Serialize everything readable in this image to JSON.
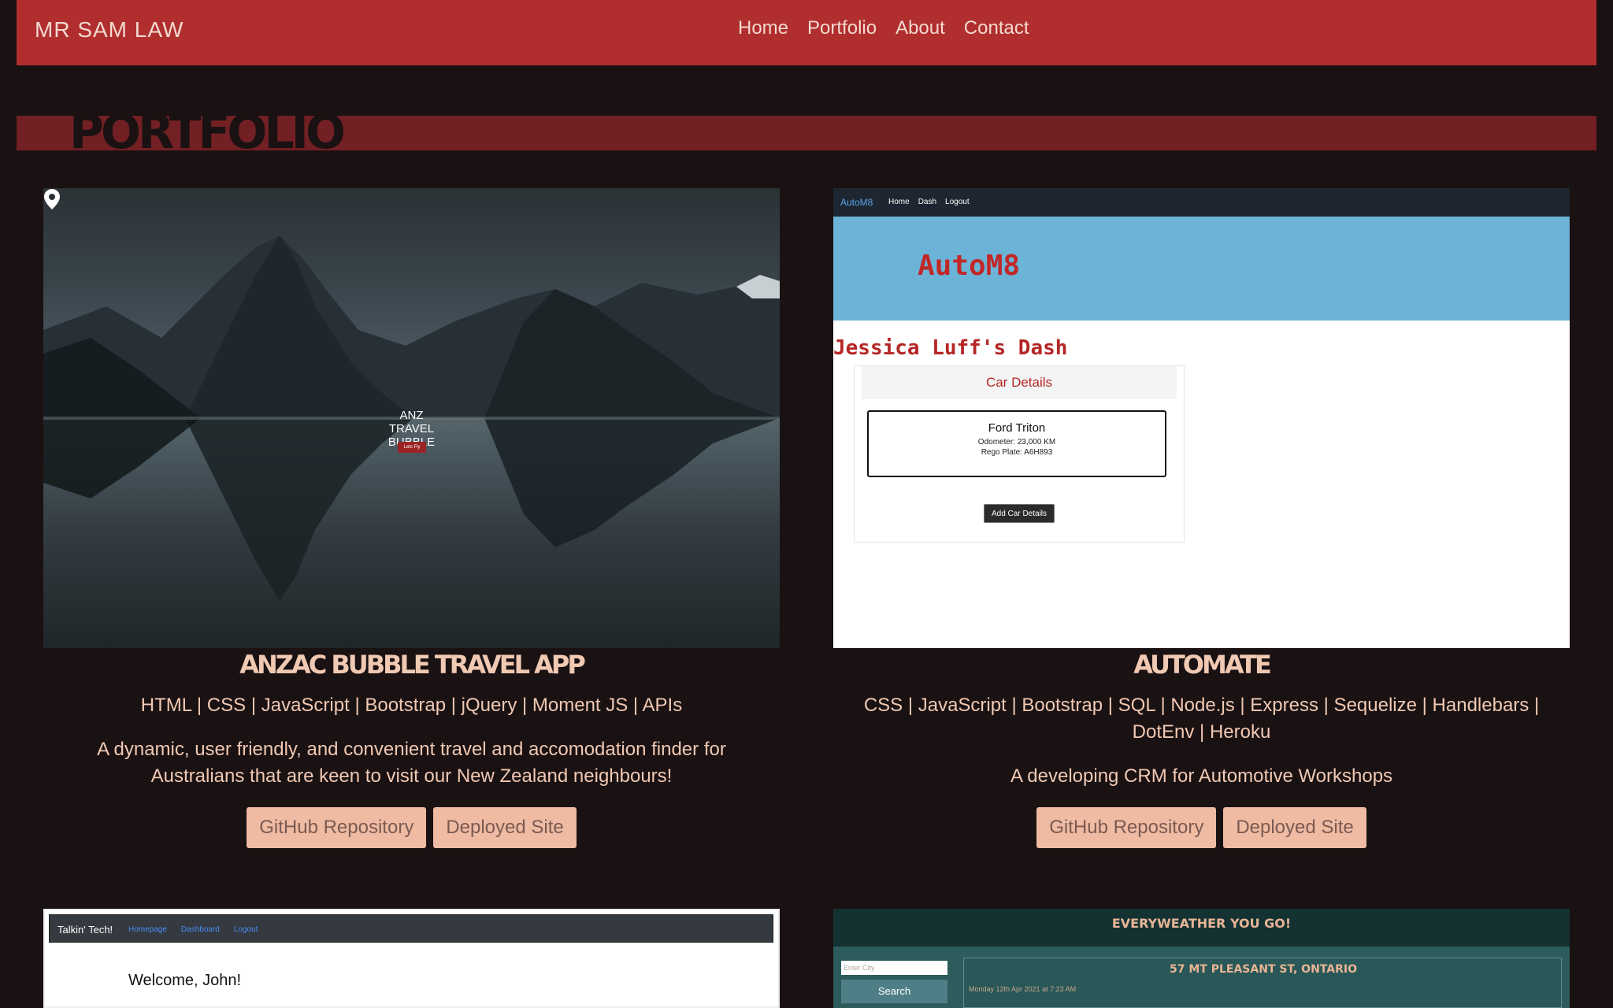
{
  "nav": {
    "brand": "MR SAM LAW",
    "links": [
      "Home",
      "Portfolio",
      "About",
      "Contact"
    ]
  },
  "section": {
    "title": "PORTFOLIO"
  },
  "projects": [
    {
      "title": "ANZAC BUBBLE TRAVEL APP",
      "tech": "HTML | CSS | JavaScript | Bootstrap | jQuery | Moment JS | APIs",
      "description": "A dynamic, user friendly, and convenient travel and accomodation finder for Australians that are keen to visit our New Zealand neighbours!",
      "github_label": "GitHub Repository",
      "deployed_label": "Deployed Site",
      "shot": {
        "title": "ANZ TRAVEL BUBBLE",
        "button": "Lets Fly"
      }
    },
    {
      "title": "AUTOMATE",
      "tech": "CSS | JavaScript | Bootstrap | SQL | Node.js | Express | Sequelize | Handlebars | DotEnv | Heroku",
      "description": "A developing CRM for Automotive Workshops",
      "github_label": "GitHub Repository",
      "deployed_label": "Deployed Site",
      "shot": {
        "brand": "AutoM8",
        "nav": [
          "Home",
          "Dash",
          "Logout"
        ],
        "hero": "AutoM8",
        "dash_title": "Jessica Luff's Dash",
        "panel_title": "Car Details",
        "car_name": "Ford Triton",
        "odometer": "Odometer: 23,000 KM",
        "rego": "Rego Plate: A6H893",
        "add_button": "Add Car Details"
      }
    },
    {
      "shot": {
        "brand": "Talkin' Tech!",
        "nav": [
          "Homepage",
          "Dashboard",
          "Logout"
        ],
        "welcome": "Welcome, John!"
      }
    },
    {
      "shot": {
        "title": "EVERYWEATHER YOU GO!",
        "input_placeholder": "Enter City",
        "search_label": "Search",
        "location": "57 MT PLEASANT ST, ONTARIO",
        "date": "Monday 12th Apr 2021 at 7:23 AM"
      }
    }
  ],
  "colors": {
    "navbar": "#b02e2e",
    "background": "#1a1112",
    "section_band": "#722024",
    "accent_text": "#f0c9b3",
    "button_bg": "#efbba2"
  }
}
